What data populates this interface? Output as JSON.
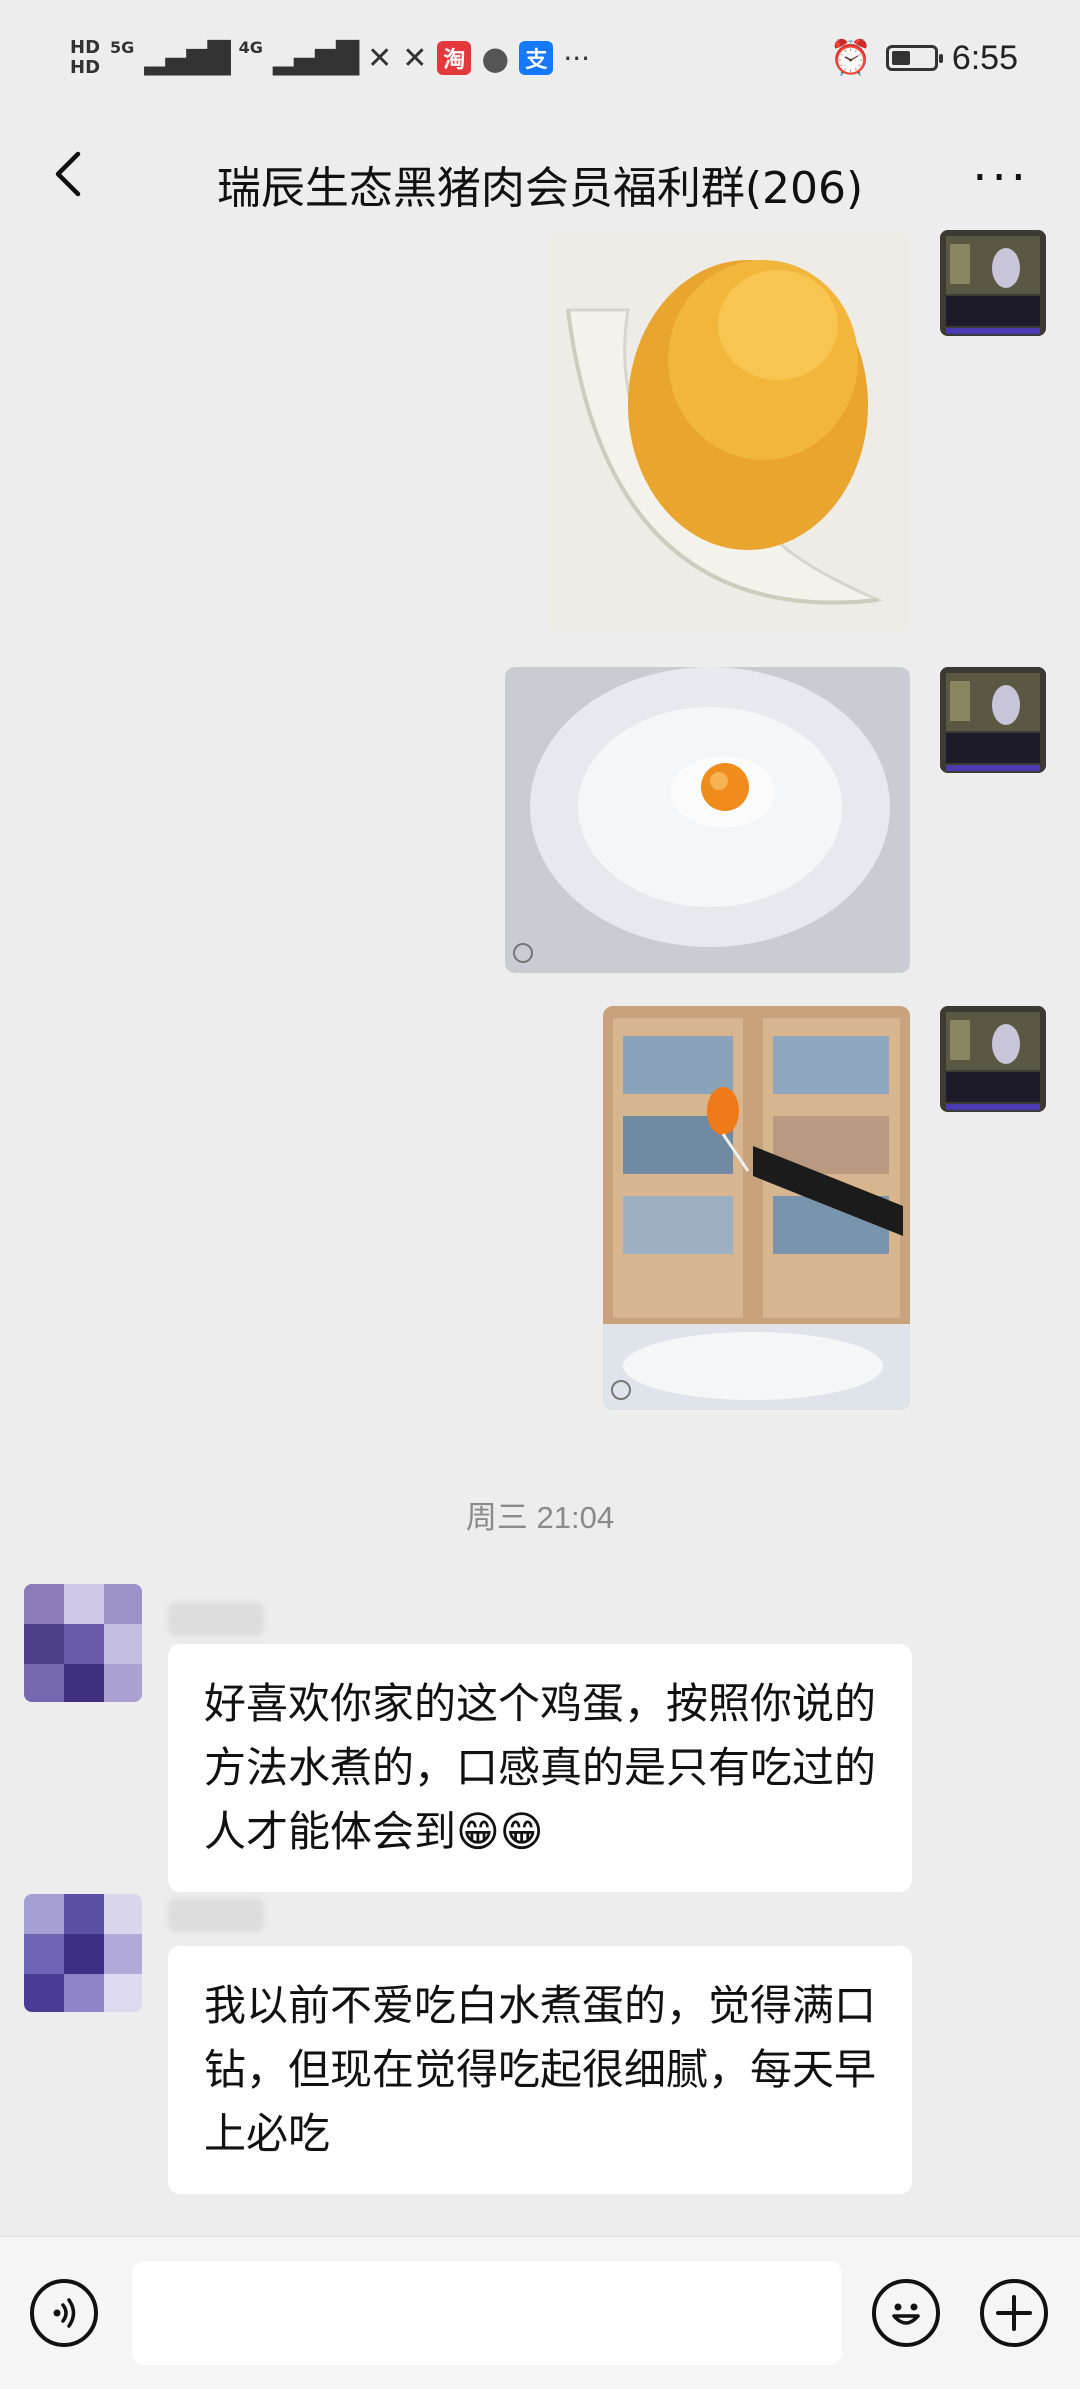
{
  "status_bar": {
    "hd1": "HD",
    "hd2": "HD",
    "net1": "5G",
    "net2": "4G",
    "taobao_icon_text": "淘",
    "alipay_icon_text": "支",
    "more_notifications": "···",
    "time": "6:55",
    "battery_level": 0.45
  },
  "header": {
    "title": "瑞辰生态黑猪肉会员福利群(206)",
    "more": "···"
  },
  "chat": {
    "time_separator": "周三 21:04",
    "messages": [
      {
        "text": "好喜欢你家的这个鸡蛋，按照你说的方法水煮的，口感真的是只有吃过的人才能体会到😁😁"
      },
      {
        "text": "我以前不爱吃白水煮蛋的，觉得满口钻，但现在觉得吃起很细腻，每天早上必吃"
      }
    ]
  },
  "colors": {
    "background": "#ededed",
    "bubble": "#ffffff",
    "timestamp": "#8a8a8a"
  }
}
